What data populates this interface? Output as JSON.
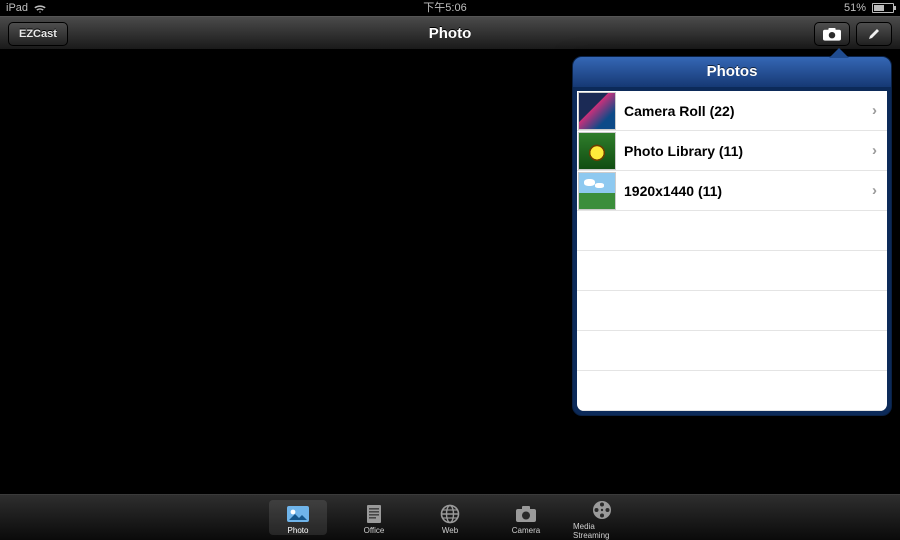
{
  "statusbar": {
    "device": "iPad",
    "time": "下午5:06",
    "battery_pct": "51%"
  },
  "nav": {
    "back": "EZCast",
    "title": "Photo"
  },
  "popover": {
    "title": "Photos",
    "albums": [
      {
        "label": "Camera Roll (22)"
      },
      {
        "label": "Photo Library (11)"
      },
      {
        "label": "1920x1440 (11)"
      }
    ]
  },
  "tabs": [
    {
      "label": "Photo"
    },
    {
      "label": "Office"
    },
    {
      "label": "Web"
    },
    {
      "label": "Camera"
    },
    {
      "label": "Media Streaming"
    }
  ]
}
